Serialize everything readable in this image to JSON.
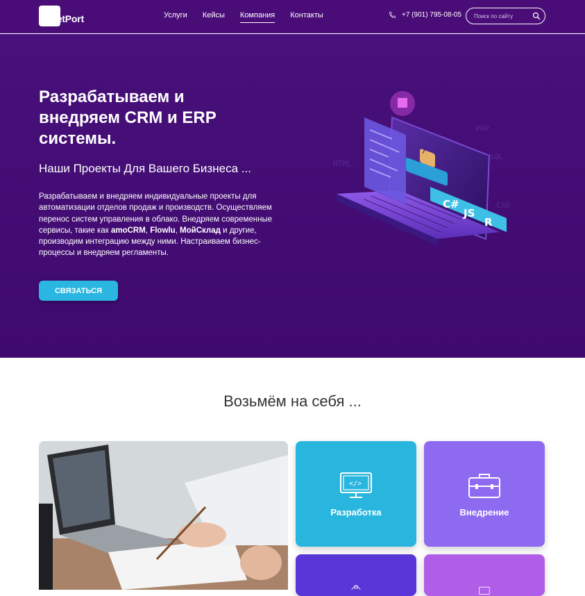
{
  "header": {
    "logo_text": "GetPort",
    "nav": [
      "Услуги",
      "Кейсы",
      "Компания",
      "Контакты"
    ],
    "active_nav": "Компания",
    "phone": "+7 (901) 795-08-05",
    "search_placeholder": "Поиск по сайту"
  },
  "hero": {
    "title": "Разрабатываем и внедряем CRM и ERP системы.",
    "subtitle": "Наши Проекты Для Вашего Бизнеса ...",
    "description_part1": "Разрабатываем и внедряем индивидуальные проекты для автоматизации отделов продаж и производств. Осуществляем перенос систем управления в облако. Внедряем современные сервисы, такие как ",
    "brand1": "amoCRM",
    "sep1": ", ",
    "brand2": "Flowlu",
    "sep2": ", ",
    "brand3": "МойСклад",
    "description_part2": " и другие, производим интеграцию между ними. Настраиваем бизнес-процессы и внедряем регламенты.",
    "cta_label": "СВЯЗАТЬСЯ",
    "illustration_labels": [
      "C#",
      "JS",
      "R"
    ]
  },
  "services": {
    "title": "Возьмём на себя ...",
    "tiles": [
      {
        "label": "Разработка",
        "icon": "monitor-code-icon",
        "color": "#29b6de"
      },
      {
        "label": "Внедрение",
        "icon": "briefcase-icon",
        "color": "#8e6af0"
      },
      {
        "label": "",
        "icon": "home-icon",
        "color": "#5a36d8"
      },
      {
        "label": "",
        "icon": "monitor-icon",
        "color": "#b05ee8"
      }
    ]
  },
  "colors": {
    "brand_purple": "#4a0d78",
    "accent_cyan": "#2ab6e0"
  }
}
